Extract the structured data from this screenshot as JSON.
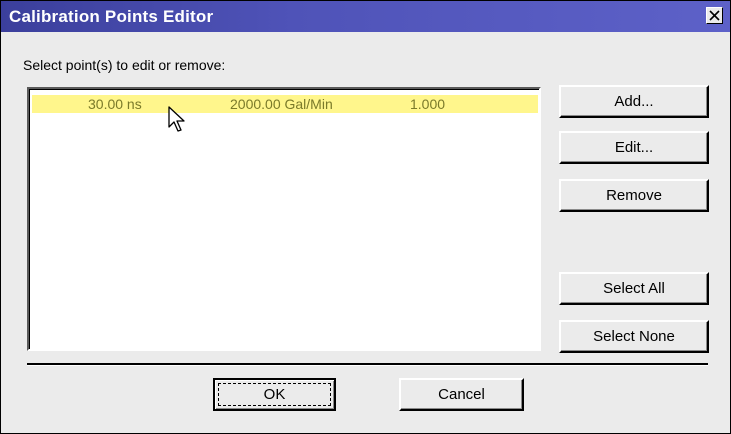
{
  "window": {
    "title": "Calibration Points Editor",
    "close_label": "X"
  },
  "instruction": "Select point(s) to edit or remove:",
  "points": [
    {
      "time": "30.00 ns",
      "flow": "2000.00 Gal/Min",
      "factor": "1.000",
      "selected": true
    }
  ],
  "buttons": {
    "add": "Add...",
    "edit": "Edit...",
    "remove": "Remove",
    "select_all": "Select All",
    "select_none": "Select None",
    "ok": "OK",
    "cancel": "Cancel"
  },
  "colors": {
    "title_bar": "#4f53b8",
    "selected_row": "#fff68c",
    "selected_text": "#7a7a2a",
    "dialog_bg": "#ebebeb"
  }
}
